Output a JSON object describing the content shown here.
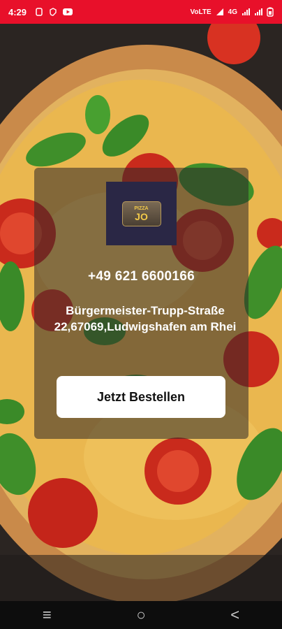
{
  "status_bar": {
    "time": "4:29",
    "network_label": "4G",
    "right_text": "VoLTE"
  },
  "card": {
    "logo": {
      "top_text": "PIZZA",
      "bottom_text": "JO"
    },
    "phone": "+49 621 6600166",
    "address": "Bürgermeister-Trupp-Straße 22,67069,Ludwigshafen am Rhei",
    "order_button_label": "Jetzt Bestellen"
  },
  "nav_bar": {
    "recents_icon": "≡",
    "home_icon": "○",
    "back_icon": "<"
  },
  "colors": {
    "status_bar_bg": "#e8102a",
    "logo_bg": "#2a2745",
    "button_bg": "#ffffff"
  }
}
